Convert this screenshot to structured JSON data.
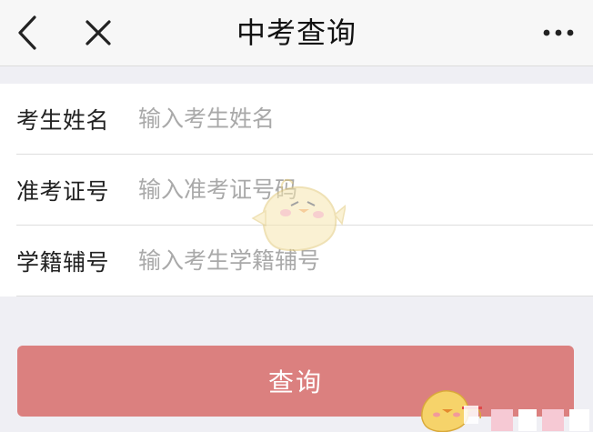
{
  "navbar": {
    "title": "中考查询",
    "back_icon": "chevron-left-icon",
    "close_icon": "close-icon",
    "more_icon": "more-horizontal-icon"
  },
  "form": {
    "fields": [
      {
        "label": "考生姓名",
        "placeholder": "输入考生姓名",
        "value": ""
      },
      {
        "label": "准考证号",
        "placeholder": "输入准考证号码",
        "value": ""
      },
      {
        "label": "学籍辅号",
        "placeholder": "输入考生学籍辅号",
        "value": ""
      }
    ]
  },
  "submit": {
    "label": "查询",
    "color": "#db807f"
  },
  "colors": {
    "background": "#efeff4",
    "navbar": "#f7f7f7",
    "placeholder": "#a9a9a9"
  },
  "watermark": {
    "icon": "chick-mascot-icon"
  }
}
